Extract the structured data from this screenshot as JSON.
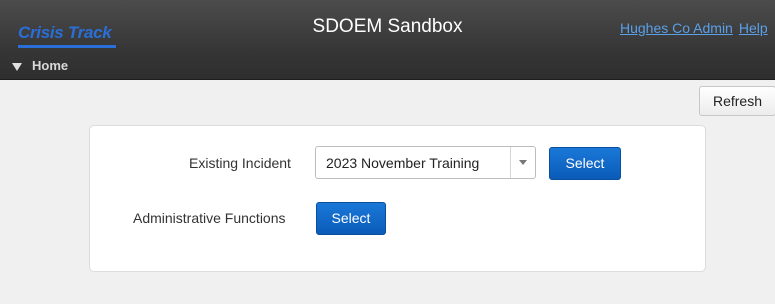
{
  "header": {
    "logo_text": "Crisis Track",
    "app_title": "SDOEM Sandbox",
    "user_link": "Hughes Co Admin",
    "help_link": "Help",
    "home_label": "Home"
  },
  "toolbar": {
    "refresh_label": "Refresh"
  },
  "panel": {
    "existing_incident_label": "Existing Incident",
    "incident_selected_value": "2023 November Training",
    "incident_select_button": "Select",
    "admin_functions_label": "Administrative Functions",
    "admin_select_button": "Select"
  },
  "colors": {
    "accent_blue": "#0b5bb8",
    "logo_blue": "#2a6fd8",
    "link_blue": "#5aa0e8",
    "header_bg": "#363636"
  },
  "icons": [
    "home-caret-icon",
    "dropdown-arrow-icon"
  ]
}
